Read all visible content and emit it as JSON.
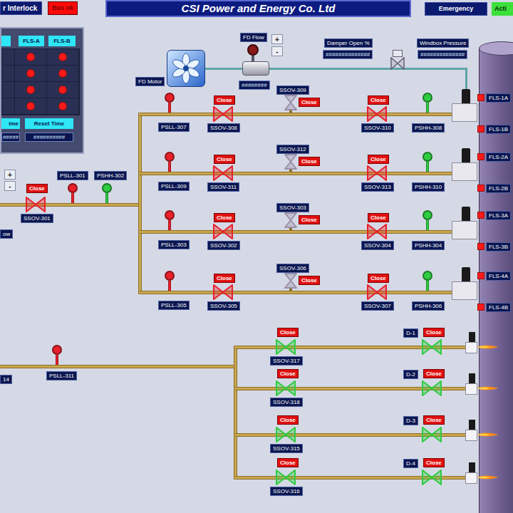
{
  "header": {
    "interlock": "r Interlock",
    "bus_status": "Bus ok",
    "title": "CSI Power and Energy Co. Ltd",
    "emergency": "Emergency",
    "mode": "Acti"
  },
  "fls_panel": {
    "columns": [
      "FLS-A",
      "FLS-B"
    ],
    "rows": [
      [
        {
          "alarm": true
        },
        {
          "alarm": true
        }
      ],
      [
        {
          "alarm": true
        },
        {
          "alarm": true
        }
      ],
      [
        {
          "alarm": true
        },
        {
          "alarm": true
        }
      ],
      [
        {
          "alarm": true
        },
        {
          "alarm": true
        }
      ]
    ],
    "time": {
      "label": "ime",
      "value": "#####"
    },
    "reset_time": {
      "label": "Reset Time",
      "value": "##########"
    }
  },
  "air": {
    "fan": "FD Motor",
    "flow": {
      "label": "FD Flow",
      "value": "########",
      "buttons": [
        "+",
        "-"
      ]
    },
    "damper": {
      "label": "Damper Open %",
      "value": "##############"
    },
    "windbox": {
      "label": "Windbox Pressure",
      "value": "##############"
    }
  },
  "gas": {
    "flow_label": "ow",
    "buttons": [
      "+",
      "-"
    ],
    "shutoff": {
      "tag": "SSOV-301",
      "status": "Close",
      "color": "#e8202a"
    },
    "switches": [
      {
        "tag": "PSLL-301",
        "color": "#e8202a"
      },
      {
        "tag": "PSHH-302",
        "color": "#2ecc40"
      }
    ]
  },
  "burners": [
    {
      "low_switch": {
        "tag": "PSLL-307",
        "color": "#e8202a"
      },
      "valves": [
        {
          "tag": "SSOV-308",
          "status": "Close",
          "color": "#e8202a",
          "kind": "inline"
        },
        {
          "tag": "SSOV-309",
          "status": "Close",
          "color": "#9a8fa8",
          "kind": "vent"
        },
        {
          "tag": "SSOV-310",
          "status": "Close",
          "color": "#e8202a",
          "kind": "inline"
        }
      ],
      "high_switch": {
        "tag": "PSHH-308",
        "color": "#2ecc40"
      },
      "flame_scanners": [
        {
          "tag": "FLS-1A",
          "color": "#ff1a1a"
        },
        {
          "tag": "FLS-1B",
          "color": "#ff1a1a"
        }
      ]
    },
    {
      "low_switch": {
        "tag": "PSLL-309",
        "color": "#e8202a"
      },
      "valves": [
        {
          "tag": "SSOV-311",
          "status": "Close",
          "color": "#e8202a",
          "kind": "inline"
        },
        {
          "tag": "SSOV-312",
          "status": "Close",
          "color": "#9a8fa8",
          "kind": "vent"
        },
        {
          "tag": "SSOV-313",
          "status": "Close",
          "color": "#e8202a",
          "kind": "inline"
        }
      ],
      "high_switch": {
        "tag": "PSHH-310",
        "color": "#2ecc40"
      },
      "flame_scanners": [
        {
          "tag": "FLS-2A",
          "color": "#ff1a1a"
        },
        {
          "tag": "FLS-2B",
          "color": "#ff1a1a"
        }
      ]
    },
    {
      "low_switch": {
        "tag": "PSLL-303",
        "color": "#e8202a"
      },
      "valves": [
        {
          "tag": "SSOV-302",
          "status": "Close",
          "color": "#e8202a",
          "kind": "inline"
        },
        {
          "tag": "SSOV-303",
          "status": "Close",
          "color": "#9a8fa8",
          "kind": "vent"
        },
        {
          "tag": "SSOV-304",
          "status": "Close",
          "color": "#e8202a",
          "kind": "inline"
        }
      ],
      "high_switch": {
        "tag": "PSHH-304",
        "color": "#2ecc40"
      },
      "flame_scanners": [
        {
          "tag": "FLS-3A",
          "color": "#ff1a1a"
        },
        {
          "tag": "FLS-3B",
          "color": "#ff1a1a"
        }
      ]
    },
    {
      "low_switch": {
        "tag": "PSLL-305",
        "color": "#e8202a"
      },
      "valves": [
        {
          "tag": "SSOV-305",
          "status": "Close",
          "color": "#e8202a",
          "kind": "inline"
        },
        {
          "tag": "SSOV-306",
          "status": "Close",
          "color": "#9a8fa8",
          "kind": "vent"
        },
        {
          "tag": "SSOV-307",
          "status": "Close",
          "color": "#e8202a",
          "kind": "inline"
        }
      ],
      "high_switch": {
        "tag": "PSHH-306",
        "color": "#2ecc40"
      },
      "flame_scanners": [
        {
          "tag": "FLS-4A",
          "color": "#ff1a1a"
        },
        {
          "tag": "FLS-4B",
          "color": "#ff1a1a"
        }
      ]
    }
  ],
  "igniters": {
    "line_tag": "14",
    "switch": {
      "tag": "PSLL-311",
      "color": "#e8202a"
    },
    "branches": [
      {
        "valve": {
          "tag": "SSOV-317",
          "status": "Close",
          "color": "#2ecc40"
        },
        "igniter_valve": {
          "tag": "D-1",
          "status": "Close",
          "color": "#2ecc40"
        },
        "flame": true
      },
      {
        "valve": {
          "tag": "SSOV-318",
          "status": "Close",
          "color": "#2ecc40"
        },
        "igniter_valve": {
          "tag": "D-2",
          "status": "Close",
          "color": "#2ecc40"
        },
        "flame": true
      },
      {
        "valve": {
          "tag": "SSOV-315",
          "status": "Close",
          "color": "#2ecc40"
        },
        "igniter_valve": {
          "tag": "D-3",
          "status": "Close",
          "color": "#2ecc40"
        },
        "flame": true
      },
      {
        "valve": {
          "tag": "SSOV-316",
          "status": "Close",
          "color": "#2ecc40"
        },
        "igniter_valve": {
          "tag": "D-4",
          "status": "Close",
          "color": "#2ecc40"
        },
        "flame": true
      }
    ]
  }
}
